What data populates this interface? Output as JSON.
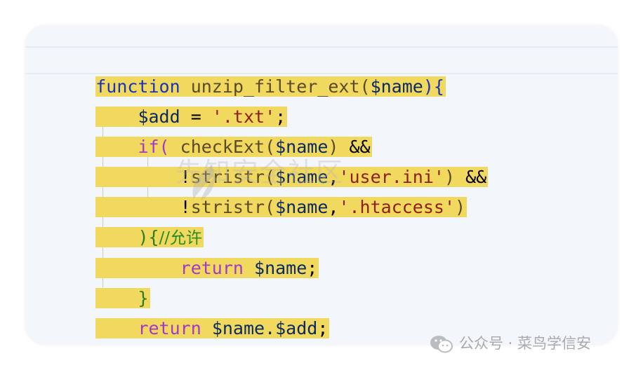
{
  "code": {
    "line1": {
      "kw": "function",
      "fn": "unzip_filter_ext(",
      "var": "$name",
      "end": "){"
    },
    "line2": {
      "var": "$add",
      "op": " = ",
      "str": "'.txt'",
      "end": ";"
    },
    "line3": {
      "ctl": "if(",
      "fn": "checkExt(",
      "var": "$name",
      "close": ")",
      "op": " &&"
    },
    "line4": {
      "op": "!",
      "fn": "stristr(",
      "var": "$name",
      "comma": ",",
      "str": "'user.ini'",
      "close": ")",
      "and": " &&"
    },
    "line5": {
      "op": "!",
      "fn": "stristr(",
      "var": "$name",
      "comma": ",",
      "str": "'.htaccess'",
      "close": ")"
    },
    "line6": {
      "par": "){",
      "cmt": "//允许"
    },
    "line7": {
      "ctl": "return",
      "var": "$name",
      "end": ";"
    },
    "line8": {
      "par": "}"
    },
    "line9": {
      "ctl": "return",
      "var": "$name.$add",
      "end": ";"
    },
    "line10": {
      "kw": "}"
    }
  },
  "watermark": "先知安全社区",
  "footer": {
    "text": "公众号 · 菜鸟学信安",
    "icon": "wechat-icon"
  }
}
